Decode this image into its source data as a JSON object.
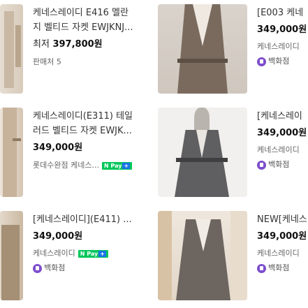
{
  "products": [
    {
      "title_line1": "케네스레이디 E416 멜란",
      "title_line2": "지 벨티드 자켓 EWJKNJ...",
      "price_prefix": "최저",
      "price": "397,800원",
      "seller": "판매처 5"
    },
    {
      "title_line1": "[E003 케네",
      "price": "349,000원",
      "seller": "케네스레이디",
      "badge": "백화점"
    },
    {
      "title_line1": "케네스레이디(E311) 테일",
      "title_line2": "러드 벨티드 자켓 EWJK...",
      "price": "349,000원",
      "seller": "롯데수완점 케네스...",
      "pay": "N Pay",
      "pay_plus": "+"
    },
    {
      "title_line1": "[케네스레이",
      "price": "349,000원",
      "seller": "케네스레이디",
      "badge": "백화점"
    },
    {
      "title_line1": "[케네스레이디](E411) ...",
      "price": "349,000원",
      "seller": "케네스레이디",
      "pay": "N Pay",
      "pay_plus": "+",
      "badge": "백화점"
    },
    {
      "title_line1": "NEW[케네스",
      "price": "349,000원",
      "seller": "케네스레이디",
      "badge": "백화점"
    }
  ]
}
